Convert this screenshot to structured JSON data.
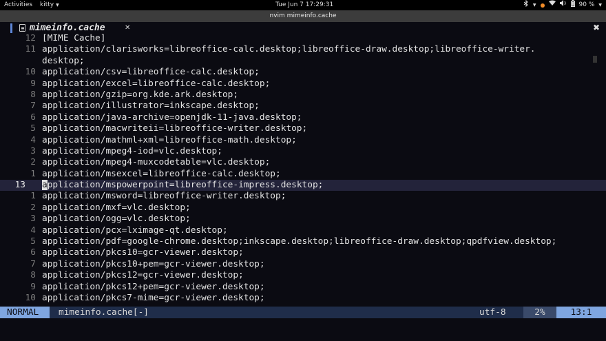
{
  "topbar": {
    "activities": "Activities",
    "app_name": "kitty",
    "clock": "Tue Jun 7  17:29:31",
    "battery": "90 %"
  },
  "window": {
    "title": "nvim mimeinfo.cache"
  },
  "tab": {
    "name": "mimeinfo.cache",
    "close": "✕",
    "right_close": "✖"
  },
  "lines": [
    {
      "num": "12",
      "text": "[MIME Cache]"
    },
    {
      "num": "11",
      "text": "application/clarisworks=libreoffice-calc.desktop;libreoffice-draw.desktop;libreoffice-writer."
    },
    {
      "num": "",
      "text": "desktop;"
    },
    {
      "num": "10",
      "text": "application/csv=libreoffice-calc.desktop;"
    },
    {
      "num": "9",
      "text": "application/excel=libreoffice-calc.desktop;"
    },
    {
      "num": "8",
      "text": "application/gzip=org.kde.ark.desktop;"
    },
    {
      "num": "7",
      "text": "application/illustrator=inkscape.desktop;"
    },
    {
      "num": "6",
      "text": "application/java-archive=openjdk-11-java.desktop;"
    },
    {
      "num": "5",
      "text": "application/macwriteii=libreoffice-writer.desktop;"
    },
    {
      "num": "4",
      "text": "application/mathml+xml=libreoffice-math.desktop;"
    },
    {
      "num": "3",
      "text": "application/mpeg4-iod=vlc.desktop;"
    },
    {
      "num": "2",
      "text": "application/mpeg4-muxcodetable=vlc.desktop;"
    },
    {
      "num": "1",
      "text": "application/msexcel=libreoffice-calc.desktop;"
    },
    {
      "num": "13",
      "text": "pplication/mspowerpoint=libreoffice-impress.desktop;",
      "cursor_char": "a",
      "current": true
    },
    {
      "num": "1",
      "text": "application/msword=libreoffice-writer.desktop;"
    },
    {
      "num": "2",
      "text": "application/mxf=vlc.desktop;"
    },
    {
      "num": "3",
      "text": "application/ogg=vlc.desktop;"
    },
    {
      "num": "4",
      "text": "application/pcx=lximage-qt.desktop;"
    },
    {
      "num": "5",
      "text": "application/pdf=google-chrome.desktop;inkscape.desktop;libreoffice-draw.desktop;qpdfview.desktop;"
    },
    {
      "num": "6",
      "text": "application/pkcs10=gcr-viewer.desktop;"
    },
    {
      "num": "7",
      "text": "application/pkcs10+pem=gcr-viewer.desktop;"
    },
    {
      "num": "8",
      "text": "application/pkcs12=gcr-viewer.desktop;"
    },
    {
      "num": "9",
      "text": "application/pkcs12+pem=gcr-viewer.desktop;"
    },
    {
      "num": "10",
      "text": "application/pkcs7-mime=gcr-viewer.desktop;"
    }
  ],
  "status": {
    "mode": "NORMAL",
    "filename": "mimeinfo.cache[-]",
    "encoding": "utf-8",
    "percent": "2%",
    "position": "13:1"
  },
  "icons": {
    "bluetooth": "bluetooth-icon",
    "wifi": "wifi-icon",
    "volume": "volume-icon",
    "battery": "battery-icon",
    "file": "file-icon"
  }
}
